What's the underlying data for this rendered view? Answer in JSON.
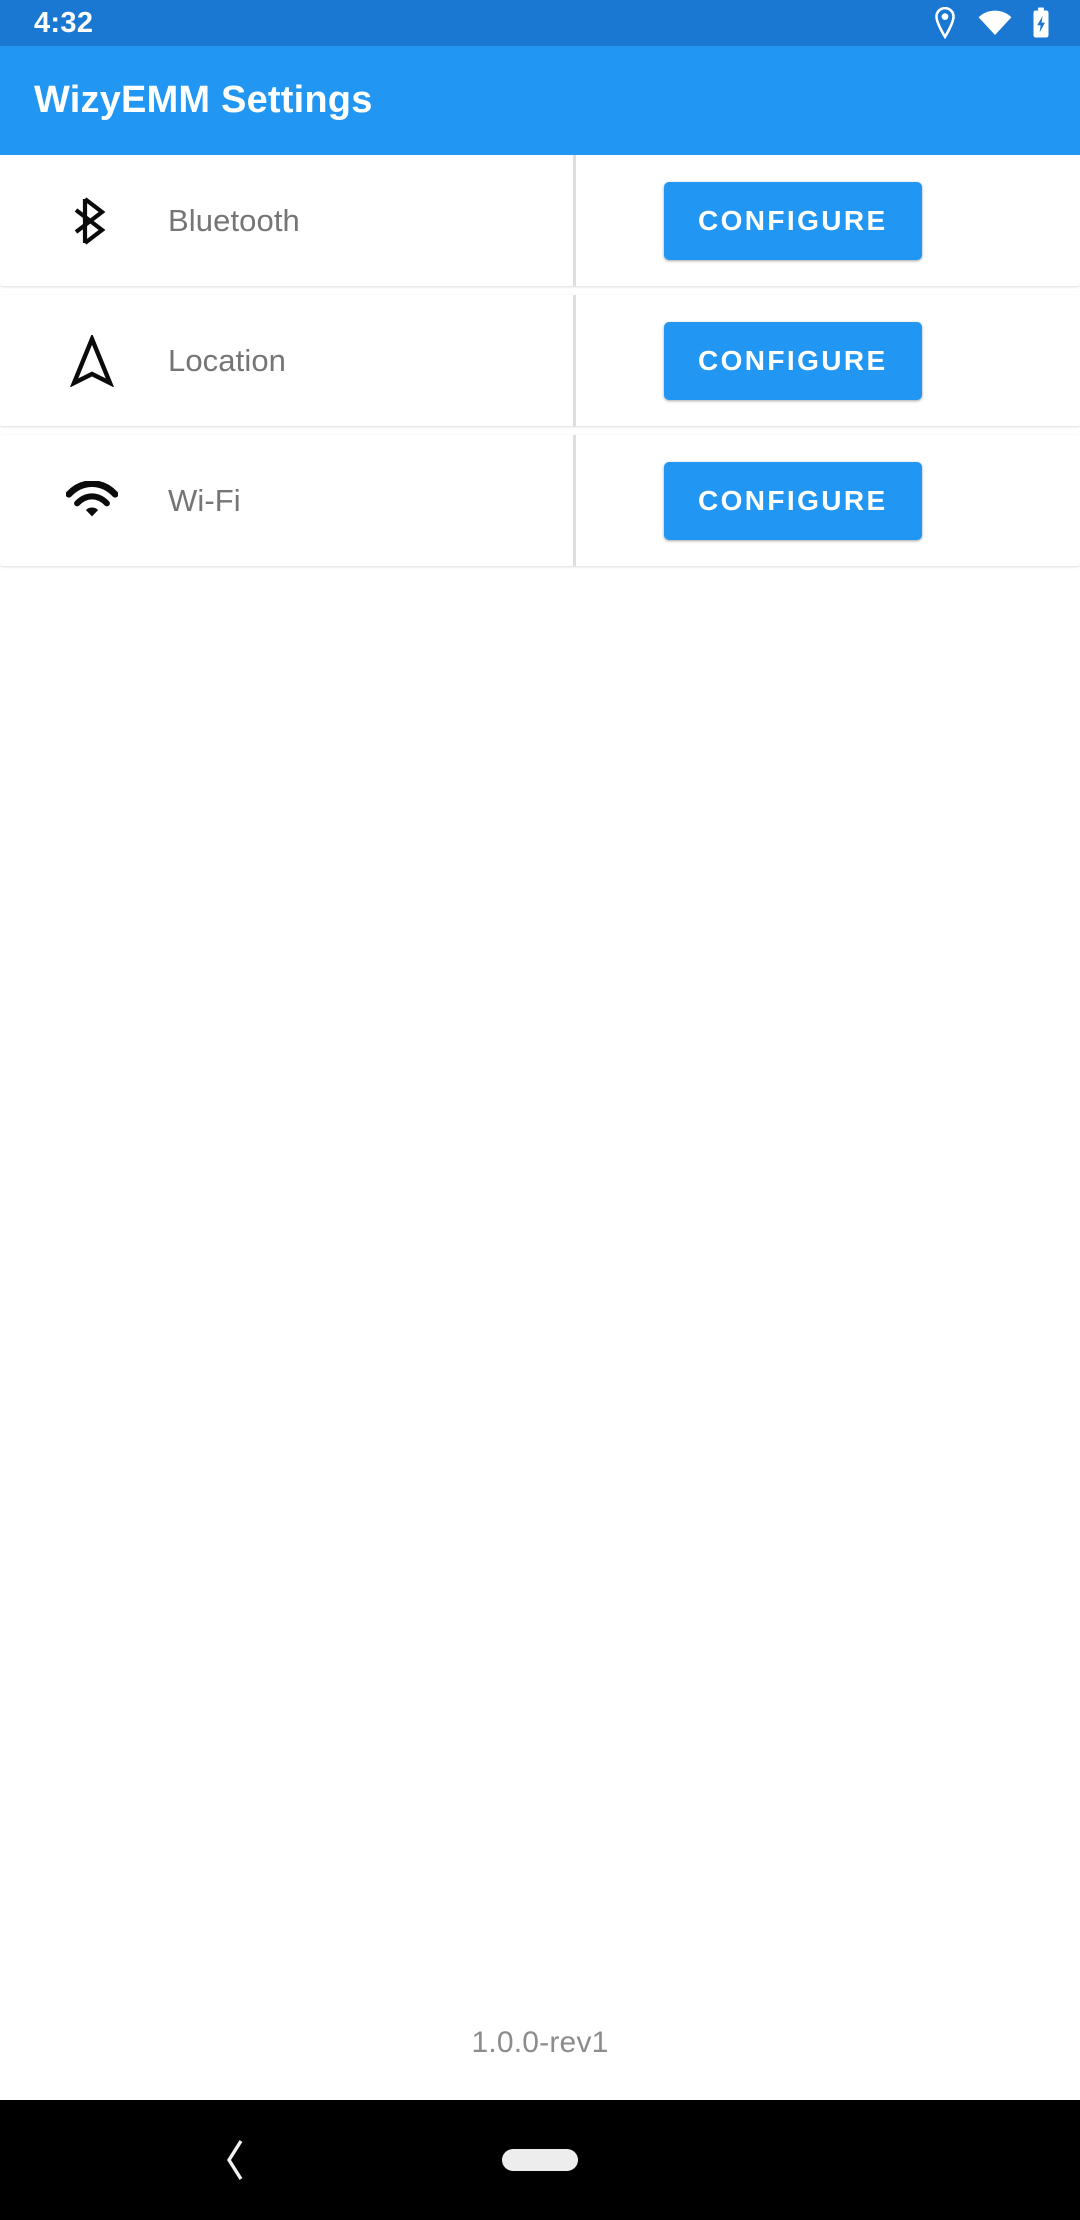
{
  "status_bar": {
    "clock": "4:32",
    "icons": [
      {
        "name": "location-icon",
        "label": "location"
      },
      {
        "name": "wifi-icon",
        "label": "wifi"
      },
      {
        "name": "battery-charging-icon",
        "label": "battery charging"
      }
    ],
    "background_color": "#1A78D2",
    "foreground_color": "#FFFFFF"
  },
  "app_bar": {
    "title": "WizyEMM Settings",
    "background_color": "#2196F3",
    "title_color": "#FFFFFF"
  },
  "settings": {
    "rows": [
      {
        "icon": "bluetooth-icon",
        "label": "Bluetooth",
        "action_label": "CONFIGURE"
      },
      {
        "icon": "location-arrow-icon",
        "label": "Location",
        "action_label": "CONFIGURE"
      },
      {
        "icon": "wifi-icon",
        "label": "Wi-Fi",
        "action_label": "CONFIGURE"
      }
    ],
    "label_color": "#757575",
    "button_color": "#2196F3",
    "button_text_color": "#FFFFFF",
    "divider_color": "#DEDEDE",
    "card_background": "#FFFFFF"
  },
  "footer": {
    "version": "1.0.0-rev1",
    "version_color": "#8C8C8C"
  },
  "nav_bar": {
    "background_color": "#000000",
    "back_icon": "chevron-left-icon",
    "home_indicator": "home-pill-indicator",
    "foreground_color": "#EDEDED"
  }
}
